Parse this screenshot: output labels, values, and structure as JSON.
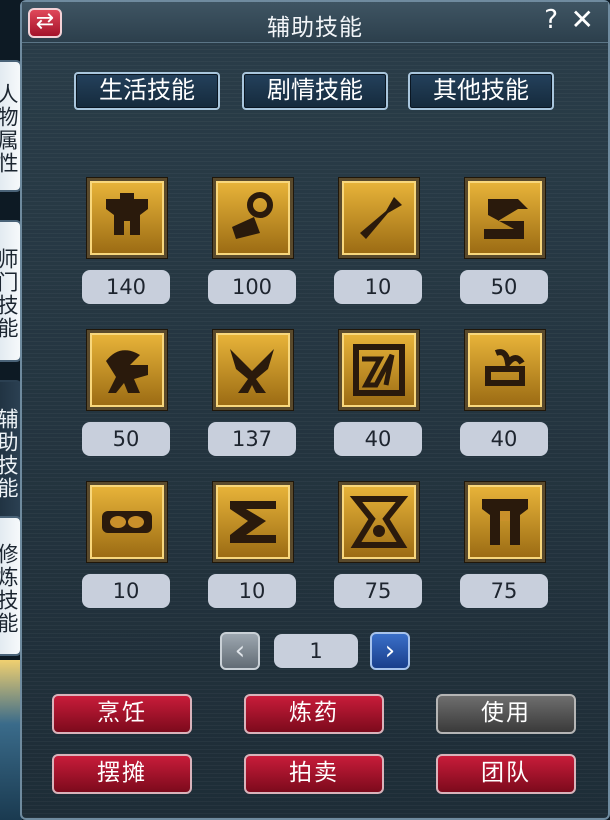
{
  "window": {
    "title": "辅助技能",
    "help_label": "?",
    "close_label": "✕",
    "swap_label": "⇄"
  },
  "side_tabs": [
    {
      "label": "人物属性",
      "active": false
    },
    {
      "label": "师门技能",
      "active": false
    },
    {
      "label": "辅助技能",
      "active": true
    },
    {
      "label": "修炼技能",
      "active": false
    }
  ],
  "category_tabs": [
    "生活技能",
    "剧情技能",
    "其他技能"
  ],
  "skills": [
    {
      "icon": "skill-icon-1",
      "level": "140"
    },
    {
      "icon": "skill-icon-2",
      "level": "100"
    },
    {
      "icon": "skill-icon-3",
      "level": "10"
    },
    {
      "icon": "skill-icon-4",
      "level": "50"
    },
    {
      "icon": "skill-icon-5",
      "level": "50"
    },
    {
      "icon": "skill-icon-6",
      "level": "137"
    },
    {
      "icon": "skill-icon-7",
      "level": "40"
    },
    {
      "icon": "skill-icon-8",
      "level": "40"
    },
    {
      "icon": "skill-icon-9",
      "level": "10"
    },
    {
      "icon": "skill-icon-10",
      "level": "10"
    },
    {
      "icon": "skill-icon-11",
      "level": "75"
    },
    {
      "icon": "skill-icon-12",
      "level": "75"
    }
  ],
  "pager": {
    "prev": "‹",
    "page": "1",
    "next": "›"
  },
  "actions": {
    "cook": "烹饪",
    "alchemy": "炼药",
    "use": "使用",
    "stall": "摆摊",
    "auction": "拍卖",
    "team": "团队"
  },
  "colors": {
    "icon_gold": "#e9b53a",
    "icon_glyph": "#2a1a0c",
    "action_red": "#c81c3a",
    "action_gray": "#6e6e6e",
    "next_blue": "#3a6fc8"
  }
}
